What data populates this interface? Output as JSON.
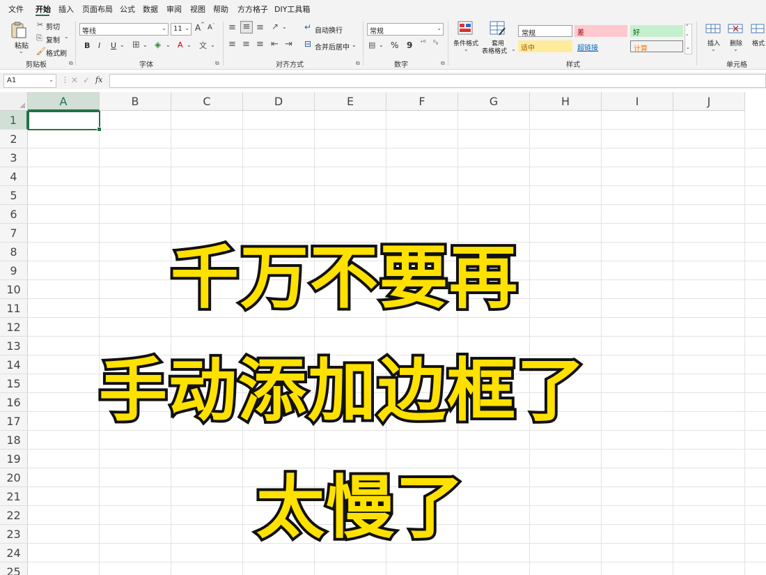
{
  "menu": {
    "items": [
      "文件",
      "开始",
      "插入",
      "页面布局",
      "公式",
      "数据",
      "审阅",
      "视图",
      "帮助",
      "方方格子",
      "DIY工具箱"
    ],
    "active_index": 1
  },
  "ribbon": {
    "clipboard": {
      "paste_label": "粘贴",
      "cut_label": "剪切",
      "copy_label": "复制",
      "format_painter_label": "格式刷",
      "group_label": "剪贴板"
    },
    "font": {
      "font_name": "等线",
      "font_size": "11",
      "bold": "B",
      "italic": "I",
      "underline": "U",
      "grow": "A",
      "shrink": "A",
      "group_label": "字体"
    },
    "alignment": {
      "wrap_label": "自动换行",
      "merge_label": "合并后居中",
      "group_label": "对齐方式"
    },
    "number": {
      "format": "常规",
      "percent": "%",
      "comma": "9",
      "group_label": "数字"
    },
    "styles": {
      "conditional_label": "条件格式",
      "table_label_1": "套用",
      "table_label_2": "表格格式",
      "cells": [
        {
          "label": "常规",
          "bg": "#ffffff",
          "color": "#222222"
        },
        {
          "label": "差",
          "bg": "#ffc7ce",
          "color": "#9c0006"
        },
        {
          "label": "好",
          "bg": "#c6efce",
          "color": "#006100"
        },
        {
          "label": "适中",
          "bg": "#ffeb9c",
          "color": "#9c5700"
        },
        {
          "label": "超链接",
          "bg": "#f3f3f3",
          "color": "#0563c1"
        },
        {
          "label": "计算",
          "bg": "#f2f2f2",
          "color": "#fa7d00"
        }
      ],
      "group_label": "样式"
    },
    "cells_group": {
      "insert_label": "插入",
      "delete_label": "删除",
      "format_label": "格式",
      "group_label": "单元格"
    }
  },
  "formula_bar": {
    "name_box": "A1",
    "fx": "fx",
    "value": ""
  },
  "grid": {
    "columns": [
      "A",
      "B",
      "C",
      "D",
      "E",
      "F",
      "G",
      "H",
      "I",
      "J"
    ],
    "rows": [
      "1",
      "2",
      "3",
      "4",
      "5",
      "6",
      "7",
      "8",
      "9",
      "10",
      "11",
      "12",
      "13",
      "14",
      "15",
      "16",
      "17",
      "18",
      "19",
      "20",
      "21",
      "22",
      "23",
      "24",
      "25"
    ],
    "selected_cell": "A1"
  },
  "headline": {
    "line1": "千万不要再",
    "line2": "手动添加边框了",
    "line3": "太慢了"
  },
  "colors": {
    "accent": "#217346",
    "headline_fill": "#ffe100",
    "headline_stroke": "#111111"
  }
}
